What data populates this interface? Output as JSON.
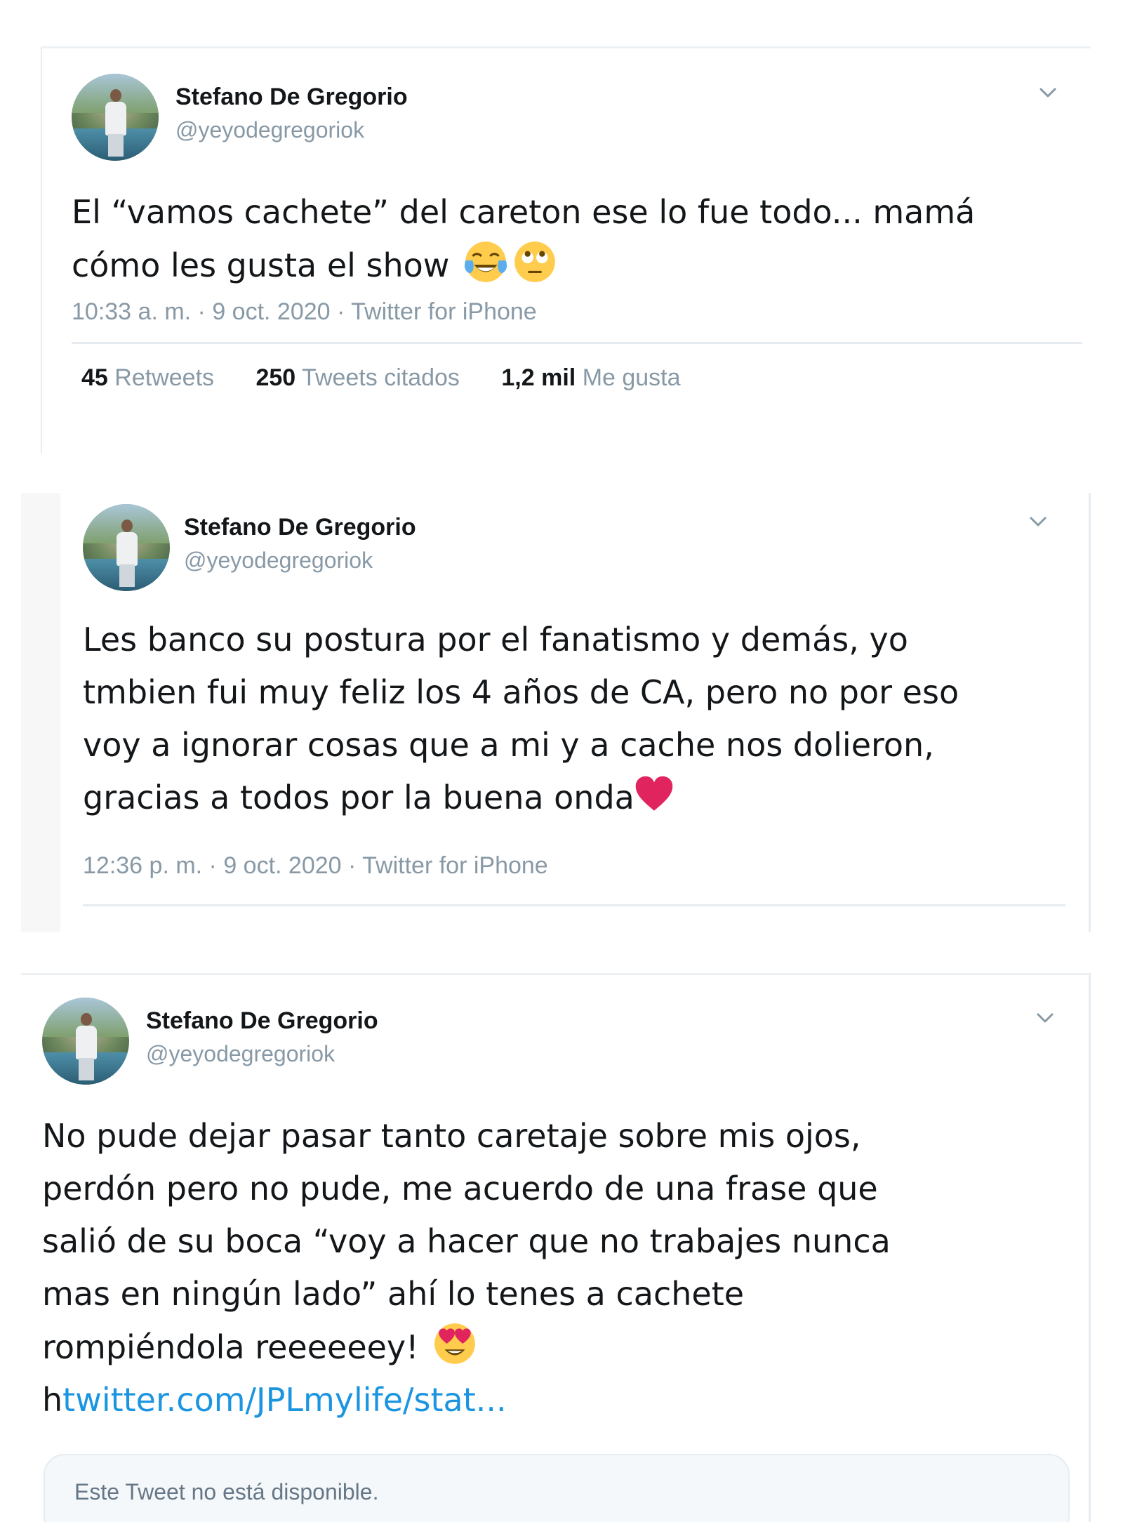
{
  "tweets": [
    {
      "author": "Stefano De Gregorio",
      "handle": "@yeyodegregoriok",
      "text_lines": [
        "El “vamos cachete” del careton ese lo fue todo... mamá",
        "cómo les gusta el show"
      ],
      "emojis": [
        "face-with-tears-of-joy-emoji",
        "face-with-rolling-eyes-emoji"
      ],
      "meta": "10:33 a. m. · 9 oct. 2020 · Twitter for iPhone",
      "stats": [
        {
          "value": "45",
          "label": "Retweets"
        },
        {
          "value": "250",
          "label": "Tweets citados"
        },
        {
          "value": "1,2 mil",
          "label": "Me gusta"
        }
      ]
    },
    {
      "author": "Stefano De Gregorio",
      "handle": "@yeyodegregoriok",
      "text_lines": [
        "Les banco su postura por el fanatismo y demás, yo",
        "tmbien fui muy feliz los 4 años de CA, pero no por eso",
        "voy a ignorar cosas que a mi y a cache nos dolieron,",
        "gracias a todos por la buena onda"
      ],
      "emojis": [
        "red-heart-emoji"
      ],
      "meta": "12:36 p. m. · 9 oct. 2020 · Twitter for iPhone"
    },
    {
      "author": "Stefano De Gregorio",
      "handle": "@yeyodegregoriok",
      "text_lines": [
        "No pude dejar pasar tanto caretaje sobre mis ojos,",
        "perdón pero no pude, me acuerdo de una frase que",
        "salió de su boca “voy a hacer que no trabajes nunca",
        "mas en ningún lado” ahí lo tenes a cachete",
        "rompiéndola reeeeeey!"
      ],
      "emojis": [
        "smiling-face-with-heart-eyes-emoji"
      ],
      "link_prefix": "h",
      "link_text": "twitter.com/JPLmylife/stat...",
      "quoted_unavailable": "Este Tweet no está disponible."
    }
  ],
  "colors": {
    "text": "#14171a",
    "secondary": "#8899a6",
    "link": "#1b95e0",
    "divider": "#e6ecf0",
    "heart": "#e0245e"
  },
  "icons": {
    "menu": "chevron-down-icon"
  }
}
